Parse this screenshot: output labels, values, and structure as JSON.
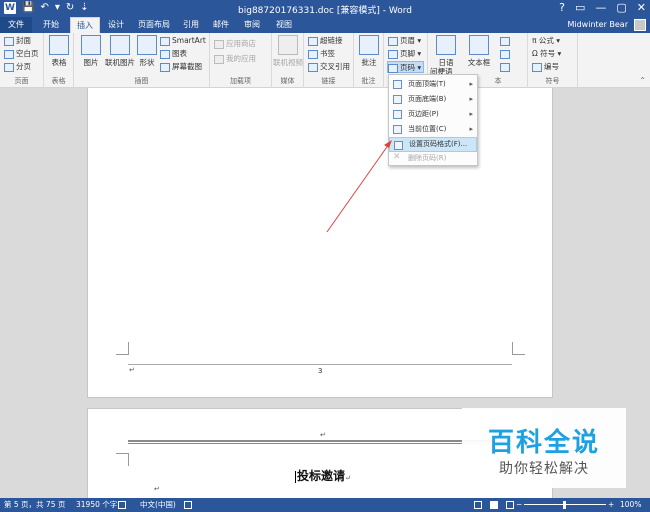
{
  "window": {
    "title": "big88720176331.doc [兼容模式] - Word",
    "help": "?",
    "minimize": "—",
    "restore": "▢",
    "close": "✕"
  },
  "qat": {
    "app_icon": "W",
    "save": "💾",
    "undo": "↶",
    "undo_arrow": "▾",
    "redo": "↻",
    "customize": "⇣"
  },
  "tabs": [
    {
      "label": "文件"
    },
    {
      "label": "开始"
    },
    {
      "label": "插入"
    },
    {
      "label": "设计"
    },
    {
      "label": "页面布局"
    },
    {
      "label": "引用"
    },
    {
      "label": "邮件"
    },
    {
      "label": "审阅"
    },
    {
      "label": "视图"
    }
  ],
  "user": {
    "name": "Midwinter Bear"
  },
  "ribbon": {
    "pages": {
      "cover": "封面",
      "blank": "空白页",
      "break": "分页",
      "label": "页面"
    },
    "tables": {
      "table": "表格",
      "label": "表格"
    },
    "illustrations": {
      "pictures": "图片",
      "online_pictures": "联机图片",
      "shapes": "形状",
      "smartart": "SmartArt",
      "chart": "图表",
      "screenshot": "屏幕截图",
      "label": "插图"
    },
    "addins": {
      "store": "应用商店",
      "my_apps": "我的应用",
      "label": "加载项"
    },
    "media": {
      "online_video": "联机视频",
      "label": "媒体"
    },
    "links": {
      "hyperlink": "超链接",
      "bookmark": "书签",
      "cross_ref": "交叉引用",
      "label": "链接"
    },
    "comments": {
      "comment": "批注",
      "label": "批注"
    },
    "header_footer": {
      "header": "页眉",
      "footer": "页脚",
      "page_number": "页码"
    },
    "text": {
      "date": "日语",
      "date2": "间梗语",
      "textbox": "文本框",
      "label": "本"
    },
    "symbols": {
      "equation": "公式",
      "symbol": "符号",
      "number": "编号",
      "label": "符号"
    }
  },
  "page_number_menu": {
    "items": [
      {
        "label": "页面顶端(T)",
        "submenu": true,
        "disabled": false,
        "highlight": false
      },
      {
        "label": "页面底端(B)",
        "submenu": true,
        "disabled": false,
        "highlight": false
      },
      {
        "label": "页边距(P)",
        "submenu": true,
        "disabled": false,
        "highlight": false
      },
      {
        "label": "当前位置(C)",
        "submenu": true,
        "disabled": false,
        "highlight": false
      },
      {
        "label": "设置页码格式(F)...",
        "submenu": false,
        "disabled": false,
        "highlight": true
      },
      {
        "label": "删除页码(R)",
        "submenu": false,
        "disabled": true,
        "highlight": false
      }
    ],
    "submenu_arrow": "▸",
    "delete_icon": "✕"
  },
  "document": {
    "page_number": "3",
    "para_mark": "↵",
    "heading": "投标邀请"
  },
  "watermark": {
    "title": "百科全说",
    "subtitle": "助你轻松解决"
  },
  "status": {
    "page": "第 5 页，共 75 页",
    "words": "31950 个字",
    "language": "中文(中国)",
    "zoom": "100%",
    "zoom_minus": "−",
    "zoom_plus": "+"
  },
  "colors": {
    "accent": "#2b579a",
    "menu_highlight": "#cde6f7",
    "annotation_arrow": "#e04040",
    "watermark": "#1da1e2"
  }
}
